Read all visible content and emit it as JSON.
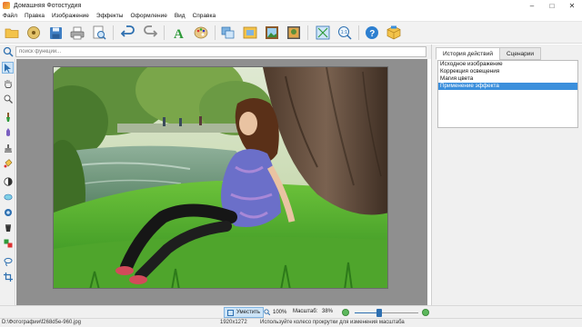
{
  "window": {
    "title": "Домашняя Фотостудия"
  },
  "menu": [
    "Файл",
    "Правка",
    "Изображение",
    "Эффекты",
    "Оформление",
    "Вид",
    "Справка"
  ],
  "search": {
    "placeholder": "поиск функций...",
    "value": ""
  },
  "toolbar": {
    "buttons": [
      "open-folder",
      "filmstrip",
      "save",
      "print",
      "preview",
      "undo",
      "redo",
      "text",
      "palette",
      "layers",
      "frame",
      "photo-frame",
      "collage",
      "resize",
      "scale",
      "help",
      "package"
    ]
  },
  "lefttools": [
    "pointer",
    "hand",
    "zoom",
    "brush",
    "dropper",
    "stamp",
    "fill",
    "eraser",
    "contrast",
    "ellipse",
    "circle",
    "bucket",
    "layers-mix",
    "lasso",
    "crop"
  ],
  "right_panel": {
    "tabs": [
      "История действий",
      "Сценарии"
    ],
    "active_tab": 0,
    "history": [
      "Исходное изображение",
      "Коррекция освещения",
      "Магия цвета",
      "Применение эффекта"
    ],
    "selected_index": 3
  },
  "zoom": {
    "fit_label": "Уместить",
    "actual_label": "100%",
    "scale_label": "Масштаб:",
    "scale_value": "38%",
    "slider_value": 0.38
  },
  "status": {
    "path": "D:\\Фотографии\\f268d5e-960.jpg",
    "dimensions": "1920x1272",
    "hint": "Используйте колесо прокрутки для изменения масштаба"
  },
  "colors": {
    "accent": "#3b8fdc",
    "selection": "#3b8fdc",
    "toolbar_bg": "#f2f2f2",
    "canvas_bg": "#8f8f8f"
  }
}
